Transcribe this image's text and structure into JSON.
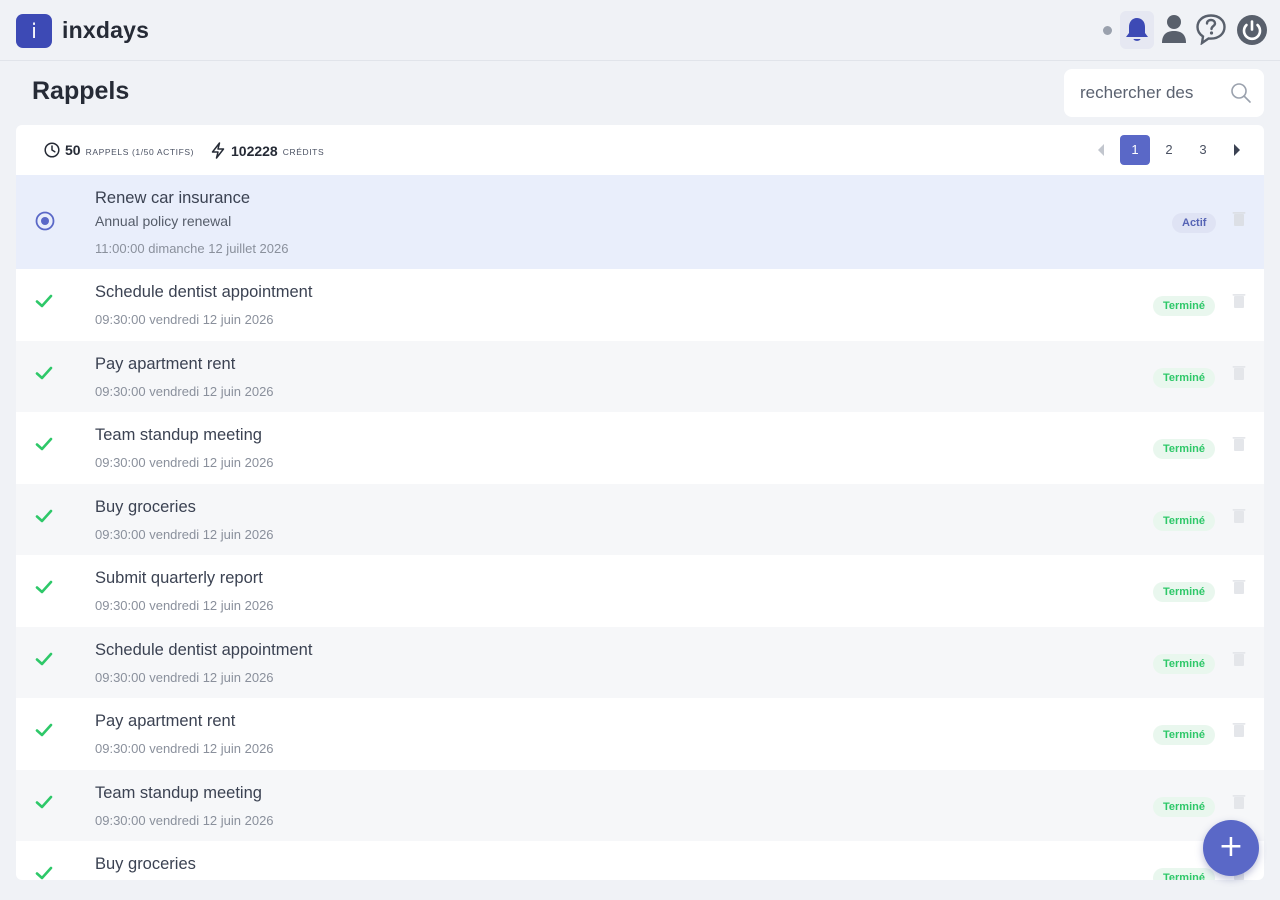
{
  "app": {
    "logo_letter": "i",
    "name": "inxdays"
  },
  "page": {
    "title": "Rappels"
  },
  "search": {
    "placeholder": "rechercher des"
  },
  "stats": {
    "reminders_count": "50",
    "reminders_label": "RAPPELS (1/50 ACTIFS)",
    "credits_count": "102228",
    "credits_label": "CRÉDITS"
  },
  "pagination": {
    "pages": [
      "1",
      "2",
      "3"
    ],
    "current": "1"
  },
  "reminders": [
    {
      "title": "Renew car insurance",
      "subtitle": "Annual policy renewal",
      "timestamp": "11:00:00 dimanche 12 juillet 2026",
      "status": "Actif"
    },
    {
      "title": "Schedule dentist appointment",
      "timestamp": "09:30:00 vendredi 12 juin 2026",
      "status": "Terminé"
    },
    {
      "title": "Pay apartment rent",
      "timestamp": "09:30:00 vendredi 12 juin 2026",
      "status": "Terminé"
    },
    {
      "title": "Team standup meeting",
      "timestamp": "09:30:00 vendredi 12 juin 2026",
      "status": "Terminé"
    },
    {
      "title": "Buy groceries",
      "timestamp": "09:30:00 vendredi 12 juin 2026",
      "status": "Terminé"
    },
    {
      "title": "Submit quarterly report",
      "timestamp": "09:30:00 vendredi 12 juin 2026",
      "status": "Terminé"
    },
    {
      "title": "Schedule dentist appointment",
      "timestamp": "09:30:00 vendredi 12 juin 2026",
      "status": "Terminé"
    },
    {
      "title": "Pay apartment rent",
      "timestamp": "09:30:00 vendredi 12 juin 2026",
      "status": "Terminé"
    },
    {
      "title": "Team standup meeting",
      "timestamp": "09:30:00 vendredi 12 juin 2026",
      "status": "Terminé"
    },
    {
      "title": "Buy groceries",
      "timestamp": "",
      "status": "Terminé"
    }
  ],
  "fab": {
    "label": "+"
  },
  "colors": {
    "primary": "#5a68c7",
    "logo": "#3d4ab5",
    "done_green": "#2ec869",
    "active_row": "#e9eefb"
  },
  "icons": [
    "notification-dot",
    "bell-icon",
    "user-icon",
    "help-icon",
    "power-icon",
    "search-icon",
    "clock-icon",
    "bolt-icon",
    "radio-active-icon",
    "check-icon",
    "trash-icon",
    "plus-icon"
  ]
}
